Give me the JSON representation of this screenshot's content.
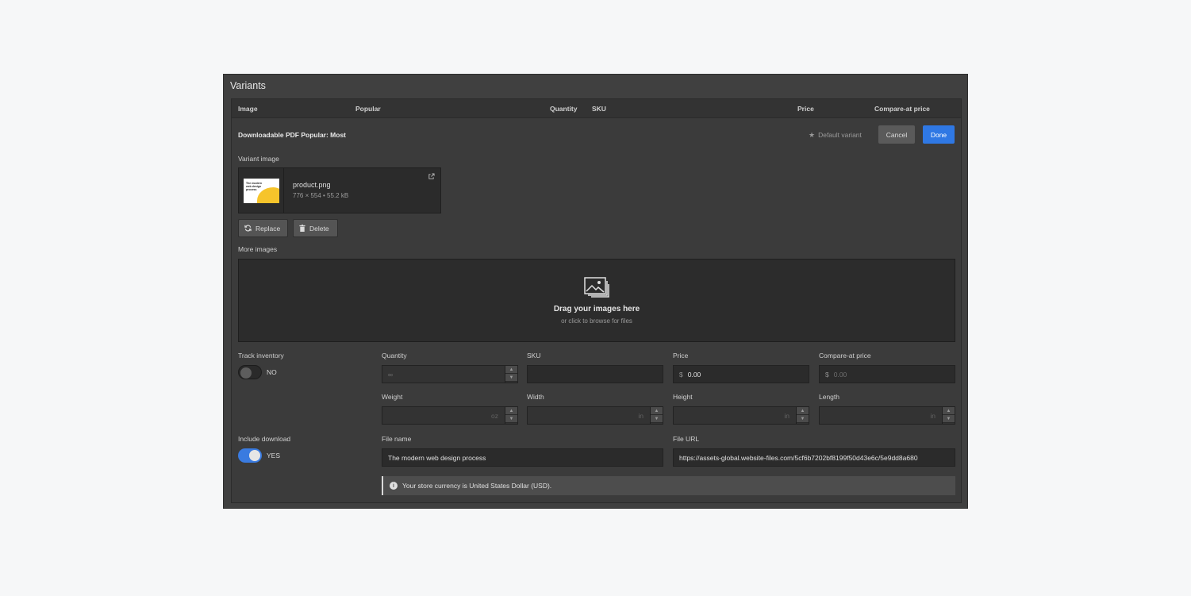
{
  "panel": {
    "title": "Variants"
  },
  "table": {
    "headers": {
      "image": "Image",
      "popular": "Popular",
      "quantity": "Quantity",
      "sku": "SKU",
      "price": "Price",
      "compare": "Compare-at price"
    }
  },
  "variant": {
    "title": "Downloadable PDF Popular: Most",
    "default_label": "Default variant",
    "cancel_label": "Cancel",
    "done_label": "Done",
    "accent_color": "#2f78e4",
    "variant_image": {
      "label": "Variant image",
      "file_name": "product.png",
      "file_meta": "776 × 554 • 55.2 kB",
      "thumb_title": "The modern web design process",
      "replace_label": "Replace",
      "delete_label": "Delete"
    },
    "more_images": {
      "label": "More images",
      "drop_title": "Drag your images here",
      "drop_sub": "or click to browse for files"
    },
    "inventory": {
      "track_label": "Track inventory",
      "track_state": "NO",
      "quantity_label": "Quantity",
      "quantity_value": "∞",
      "sku_label": "SKU",
      "sku_value": "",
      "price_label": "Price",
      "price_currency": "$",
      "price_value": "0.00",
      "compare_label": "Compare-at price",
      "compare_currency": "$",
      "compare_value": "0.00"
    },
    "dimensions": {
      "weight_label": "Weight",
      "weight_unit": "oz",
      "width_label": "Width",
      "width_unit": "in",
      "height_label": "Height",
      "height_unit": "in",
      "length_label": "Length",
      "length_unit": "in"
    },
    "download": {
      "include_label": "Include download",
      "include_state": "YES",
      "file_name_label": "File name",
      "file_name_value": "The modern web design process",
      "file_url_label": "File URL",
      "file_url_value": "https://assets-global.website-files.com/5cf6b7202bf8199f50d43e6c/5e9dd8a680"
    },
    "notice": "Your store currency is United States Dollar (USD)."
  }
}
